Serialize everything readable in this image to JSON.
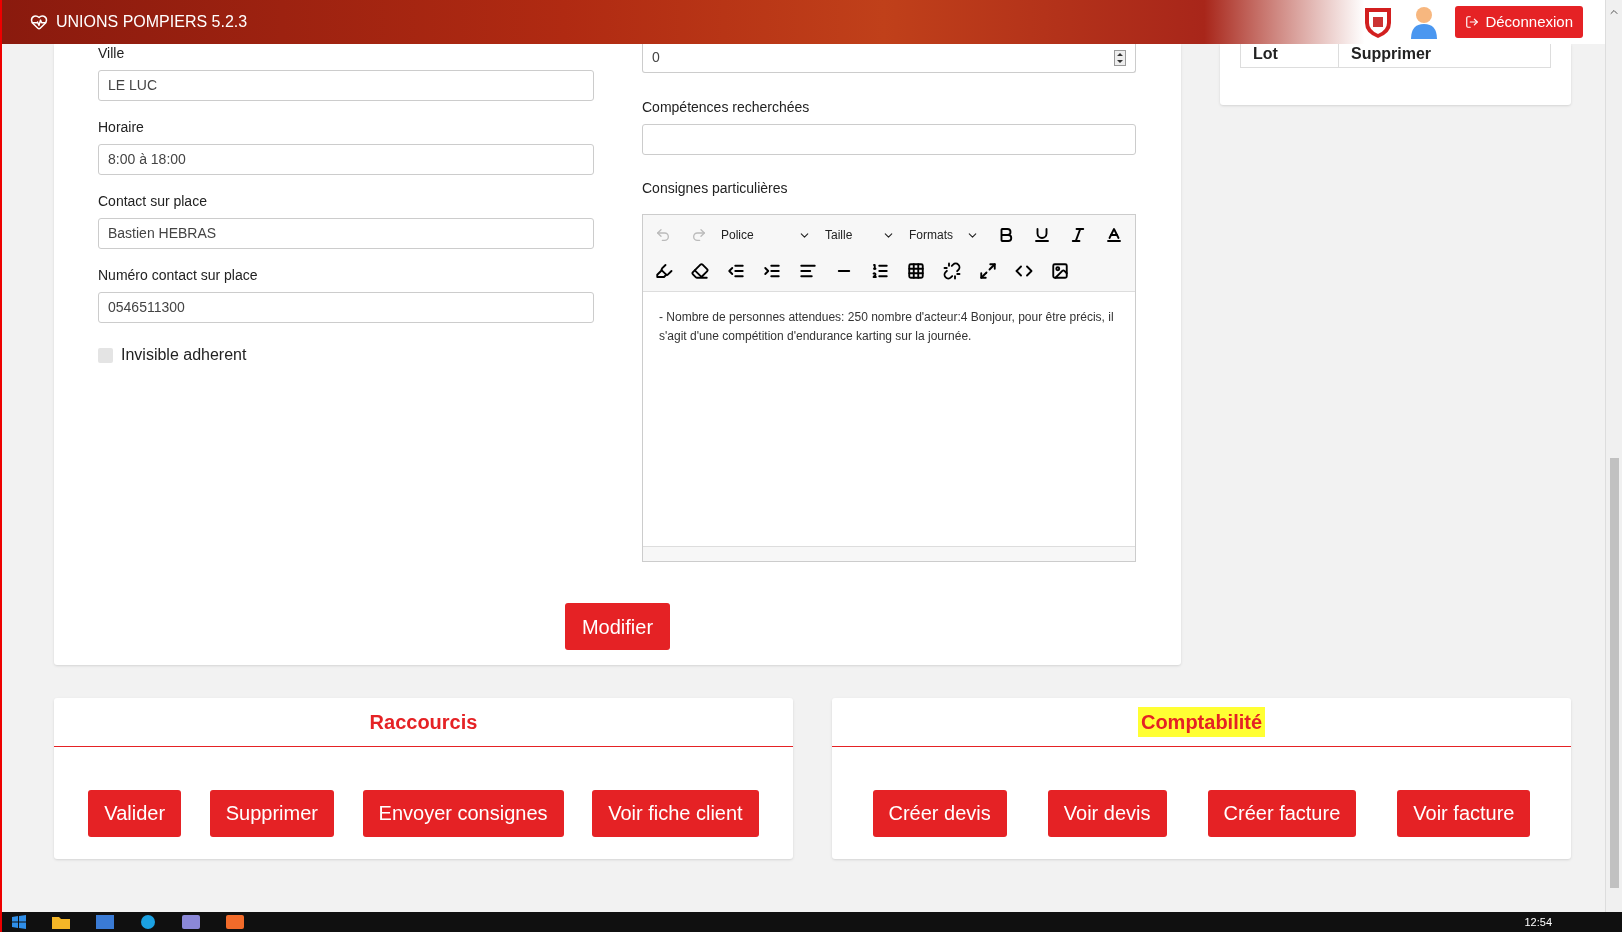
{
  "app": {
    "title": "UNIONS POMPIERS 5.2.3",
    "logout": "Déconnexion"
  },
  "side_table": {
    "columns": [
      "Lot",
      "Supprimer"
    ]
  },
  "left_fields": [
    {
      "label": "Ville",
      "value": "LE LUC"
    },
    {
      "label": "Horaire",
      "value": "8:00 à 18:00"
    },
    {
      "label": "Contact sur place",
      "value": "Bastien HEBRAS"
    },
    {
      "label": "Numéro contact sur place",
      "value": "0546511300"
    }
  ],
  "invisible_checkbox": {
    "label": "Invisible adherent",
    "checked": false
  },
  "number_field": {
    "value": "0"
  },
  "skills_field": {
    "label": "Compétences recherchées"
  },
  "instructions": {
    "label": "Consignes particulières",
    "dropdowns": [
      "Police",
      "Taille",
      "Formats"
    ],
    "content": "- Nombre de personnes attendues: 250 nombre d'acteur:4 Bonjour, pour être précis, il s'agit d'une compétition d'endurance karting sur la journée."
  },
  "submit": "Modifier",
  "panels": [
    {
      "title": "Raccourcis",
      "highlighted": false,
      "buttons": [
        "Valider",
        "Supprimer",
        "Envoyer consignes",
        "Voir fiche client"
      ]
    },
    {
      "title": "Comptabilité",
      "highlighted": true,
      "buttons": [
        "Créer devis",
        "Voir devis",
        "Créer facture",
        "Voir facture"
      ]
    }
  ],
  "taskbar": {
    "clock": "12:54"
  }
}
